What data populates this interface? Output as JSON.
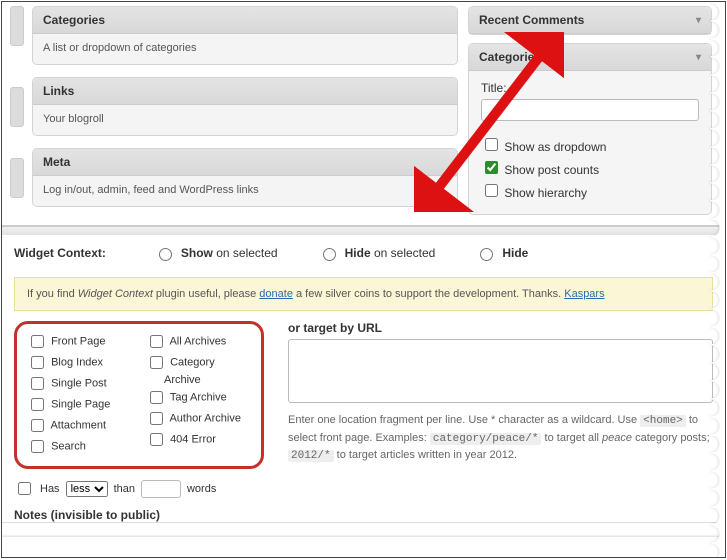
{
  "widgets": {
    "categories": {
      "title": "Categories",
      "desc": "A list or dropdown of categories"
    },
    "links": {
      "title": "Links",
      "desc": "Your blogroll"
    },
    "meta": {
      "title": "Meta",
      "desc": "Log in/out, admin, feed and WordPress links"
    }
  },
  "sidebar_panels": {
    "recent_comments": {
      "title": "Recent Comments"
    },
    "categories": {
      "title": "Categories",
      "title_label": "Title:",
      "dropdown_label": "Show as dropdown",
      "counts_label": "Show post counts",
      "hierarchy_label": "Show hierarchy",
      "dropdown_checked": false,
      "counts_checked": true,
      "hierarchy_checked": false
    }
  },
  "context": {
    "group_label": "Widget Context:",
    "radio_show_b": "Show",
    "radio_show_rest": " on selected",
    "radio_hide_b": "Hide",
    "radio_hide_rest": " on selected",
    "radio_hide_only": "Hide",
    "donation_pre": "If you find ",
    "donation_em": "Widget Context",
    "donation_mid": " plugin useful, please ",
    "donation_link": "donate",
    "donation_post": " a few silver coins to support the development. Thanks. ",
    "donation_author": "Kaspars",
    "locations": {
      "front_page": "Front Page",
      "blog_index": "Blog Index",
      "single_post": "Single Post",
      "single_page": "Single Page",
      "attachment": "Attachment",
      "search": "Search",
      "all_archives": "All Archives",
      "category_archive": "Category Archive",
      "tag_archive": "Tag Archive",
      "author_archive": "Author Archive",
      "error_404": "404 Error"
    },
    "url_title": "or target by URL",
    "help_a": "Enter one location fragment per line. Use * character as a wildcard. Use ",
    "help_home": "<home>",
    "help_b": " to select front page. Examples: ",
    "help_ex1": "category/peace/*",
    "help_c": " to target all ",
    "help_em": "peace",
    "help_d": " category posts; ",
    "help_ex2": "2012/*",
    "help_e": " to target articles written in year 2012.",
    "has_label": "Has",
    "has_select": "less",
    "than_label": "than",
    "words_label": "words",
    "notes_label": "Notes (invisible to public)"
  }
}
